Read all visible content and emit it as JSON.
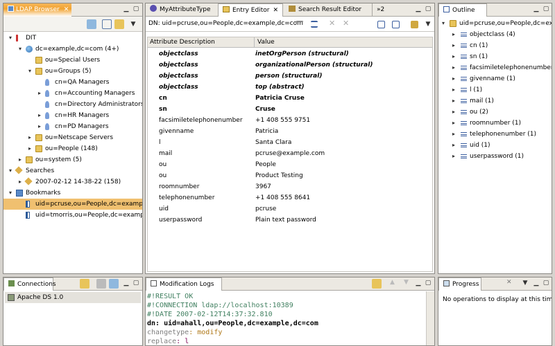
{
  "ldap_browser": {
    "tab_title": "LDAP Browser",
    "tree": [
      {
        "label": "DIT",
        "twisty": "▾",
        "indent": 0,
        "icon": "dit"
      },
      {
        "label": "dc=example,dc=com (4+)",
        "twisty": "▾",
        "indent": 1,
        "icon": "globe"
      },
      {
        "label": "ou=Special Users",
        "twisty": "",
        "indent": 2,
        "icon": "folder"
      },
      {
        "label": "ou=Groups (5)",
        "twisty": "▾",
        "indent": 2,
        "icon": "folder"
      },
      {
        "label": "cn=QA Managers",
        "twisty": "",
        "indent": 3,
        "icon": "person"
      },
      {
        "label": "cn=Accounting Managers",
        "twisty": "▸",
        "indent": 3,
        "icon": "person"
      },
      {
        "label": "cn=Directory Administrators",
        "twisty": "",
        "indent": 3,
        "icon": "person"
      },
      {
        "label": "cn=HR Managers",
        "twisty": "▸",
        "indent": 3,
        "icon": "person"
      },
      {
        "label": "cn=PD Managers",
        "twisty": "▸",
        "indent": 3,
        "icon": "person"
      },
      {
        "label": "ou=Netscape Servers",
        "twisty": "▸",
        "indent": 2,
        "icon": "folder"
      },
      {
        "label": "ou=People (148)",
        "twisty": "▸",
        "indent": 2,
        "icon": "folder"
      },
      {
        "label": "ou=system (5)",
        "twisty": "▸",
        "indent": 1,
        "icon": "folder"
      },
      {
        "label": "Searches",
        "twisty": "▾",
        "indent": 0,
        "icon": "search"
      },
      {
        "label": "2007-02-12 14-38-22 (158)",
        "twisty": "▸",
        "indent": 1,
        "icon": "search"
      },
      {
        "label": "Bookmarks",
        "twisty": "▾",
        "indent": 0,
        "icon": "book"
      },
      {
        "label": "uid=pcruse,ou=People,dc=example",
        "twisty": "",
        "indent": 1,
        "icon": "bm",
        "selected": true
      },
      {
        "label": "uid=tmorris,ou=People,dc=exampl",
        "twisty": "",
        "indent": 1,
        "icon": "bm"
      }
    ]
  },
  "editor": {
    "tabs": [
      "MyAttributeType",
      "Entry Editor",
      "Search Result Editor",
      "»2"
    ],
    "dn_label": "DN: uid=pcruse,ou=People,dc=example,dc=com",
    "col_attr": "Attribute Description",
    "col_value": "Value",
    "rows": [
      {
        "attr": "objectclass",
        "value": "inetOrgPerson (structural)",
        "style": "bi"
      },
      {
        "attr": "objectclass",
        "value": "organizationalPerson (structural)",
        "style": "bi"
      },
      {
        "attr": "objectclass",
        "value": "person (structural)",
        "style": "bi"
      },
      {
        "attr": "objectclass",
        "value": "top (abstract)",
        "style": "bi"
      },
      {
        "attr": "cn",
        "value": "Patricia Cruse",
        "style": "b"
      },
      {
        "attr": "sn",
        "value": "Cruse",
        "style": "b"
      },
      {
        "attr": "facsimiletelephonenumber",
        "value": "+1 408 555 9751",
        "style": ""
      },
      {
        "attr": "givenname",
        "value": "Patricia",
        "style": ""
      },
      {
        "attr": "l",
        "value": "Santa Clara",
        "style": ""
      },
      {
        "attr": "mail",
        "value": "pcruse@example.com",
        "style": ""
      },
      {
        "attr": "ou",
        "value": "People",
        "style": ""
      },
      {
        "attr": "ou",
        "value": "Product Testing",
        "style": ""
      },
      {
        "attr": "roomnumber",
        "value": "3967",
        "style": ""
      },
      {
        "attr": "telephonenumber",
        "value": "+1 408 555 8641",
        "style": ""
      },
      {
        "attr": "uid",
        "value": "pcruse",
        "style": ""
      },
      {
        "attr": "userpassword",
        "value": "Plain text password",
        "style": ""
      }
    ]
  },
  "outline": {
    "tab_title": "Outline",
    "root": "uid=pcruse,ou=People,dc=example,dc=com",
    "items": [
      "objectclass (4)",
      "cn (1)",
      "sn (1)",
      "facsimiletelephonenumber (1)",
      "givenname (1)",
      "l (1)",
      "mail (1)",
      "ou (2)",
      "roomnumber (1)",
      "telephonenumber (1)",
      "uid (1)",
      "userpassword (1)"
    ]
  },
  "connections": {
    "tab_title": "Connections",
    "items": [
      "Apache DS 1.0"
    ]
  },
  "modlogs": {
    "tab_title": "Modification Logs",
    "lines": [
      {
        "text": "#!RESULT OK",
        "color": "#3f7f5f"
      },
      {
        "text": "#!CONNECTION ldap://localhost:10389",
        "color": "#3f7f5f"
      },
      {
        "text": "#!DATE 2007-02-12T14:37:32.810",
        "color": "#3f7f5f"
      },
      {
        "key": "dn",
        "text": ": uid=ahall,ou=People,dc=example,dc=com",
        "keycolor": "#000",
        "color": "#000",
        "bold": true
      },
      {
        "key": "changetype",
        "text": ": modify",
        "keycolor": "#7f7f7f",
        "color": "#b0791a"
      },
      {
        "key": "replace",
        "text": ": l",
        "keycolor": "#7f7f7f",
        "color": "#7f0055"
      }
    ]
  },
  "progress": {
    "tab_title": "Progress",
    "message": "No operations to display at this tim"
  }
}
